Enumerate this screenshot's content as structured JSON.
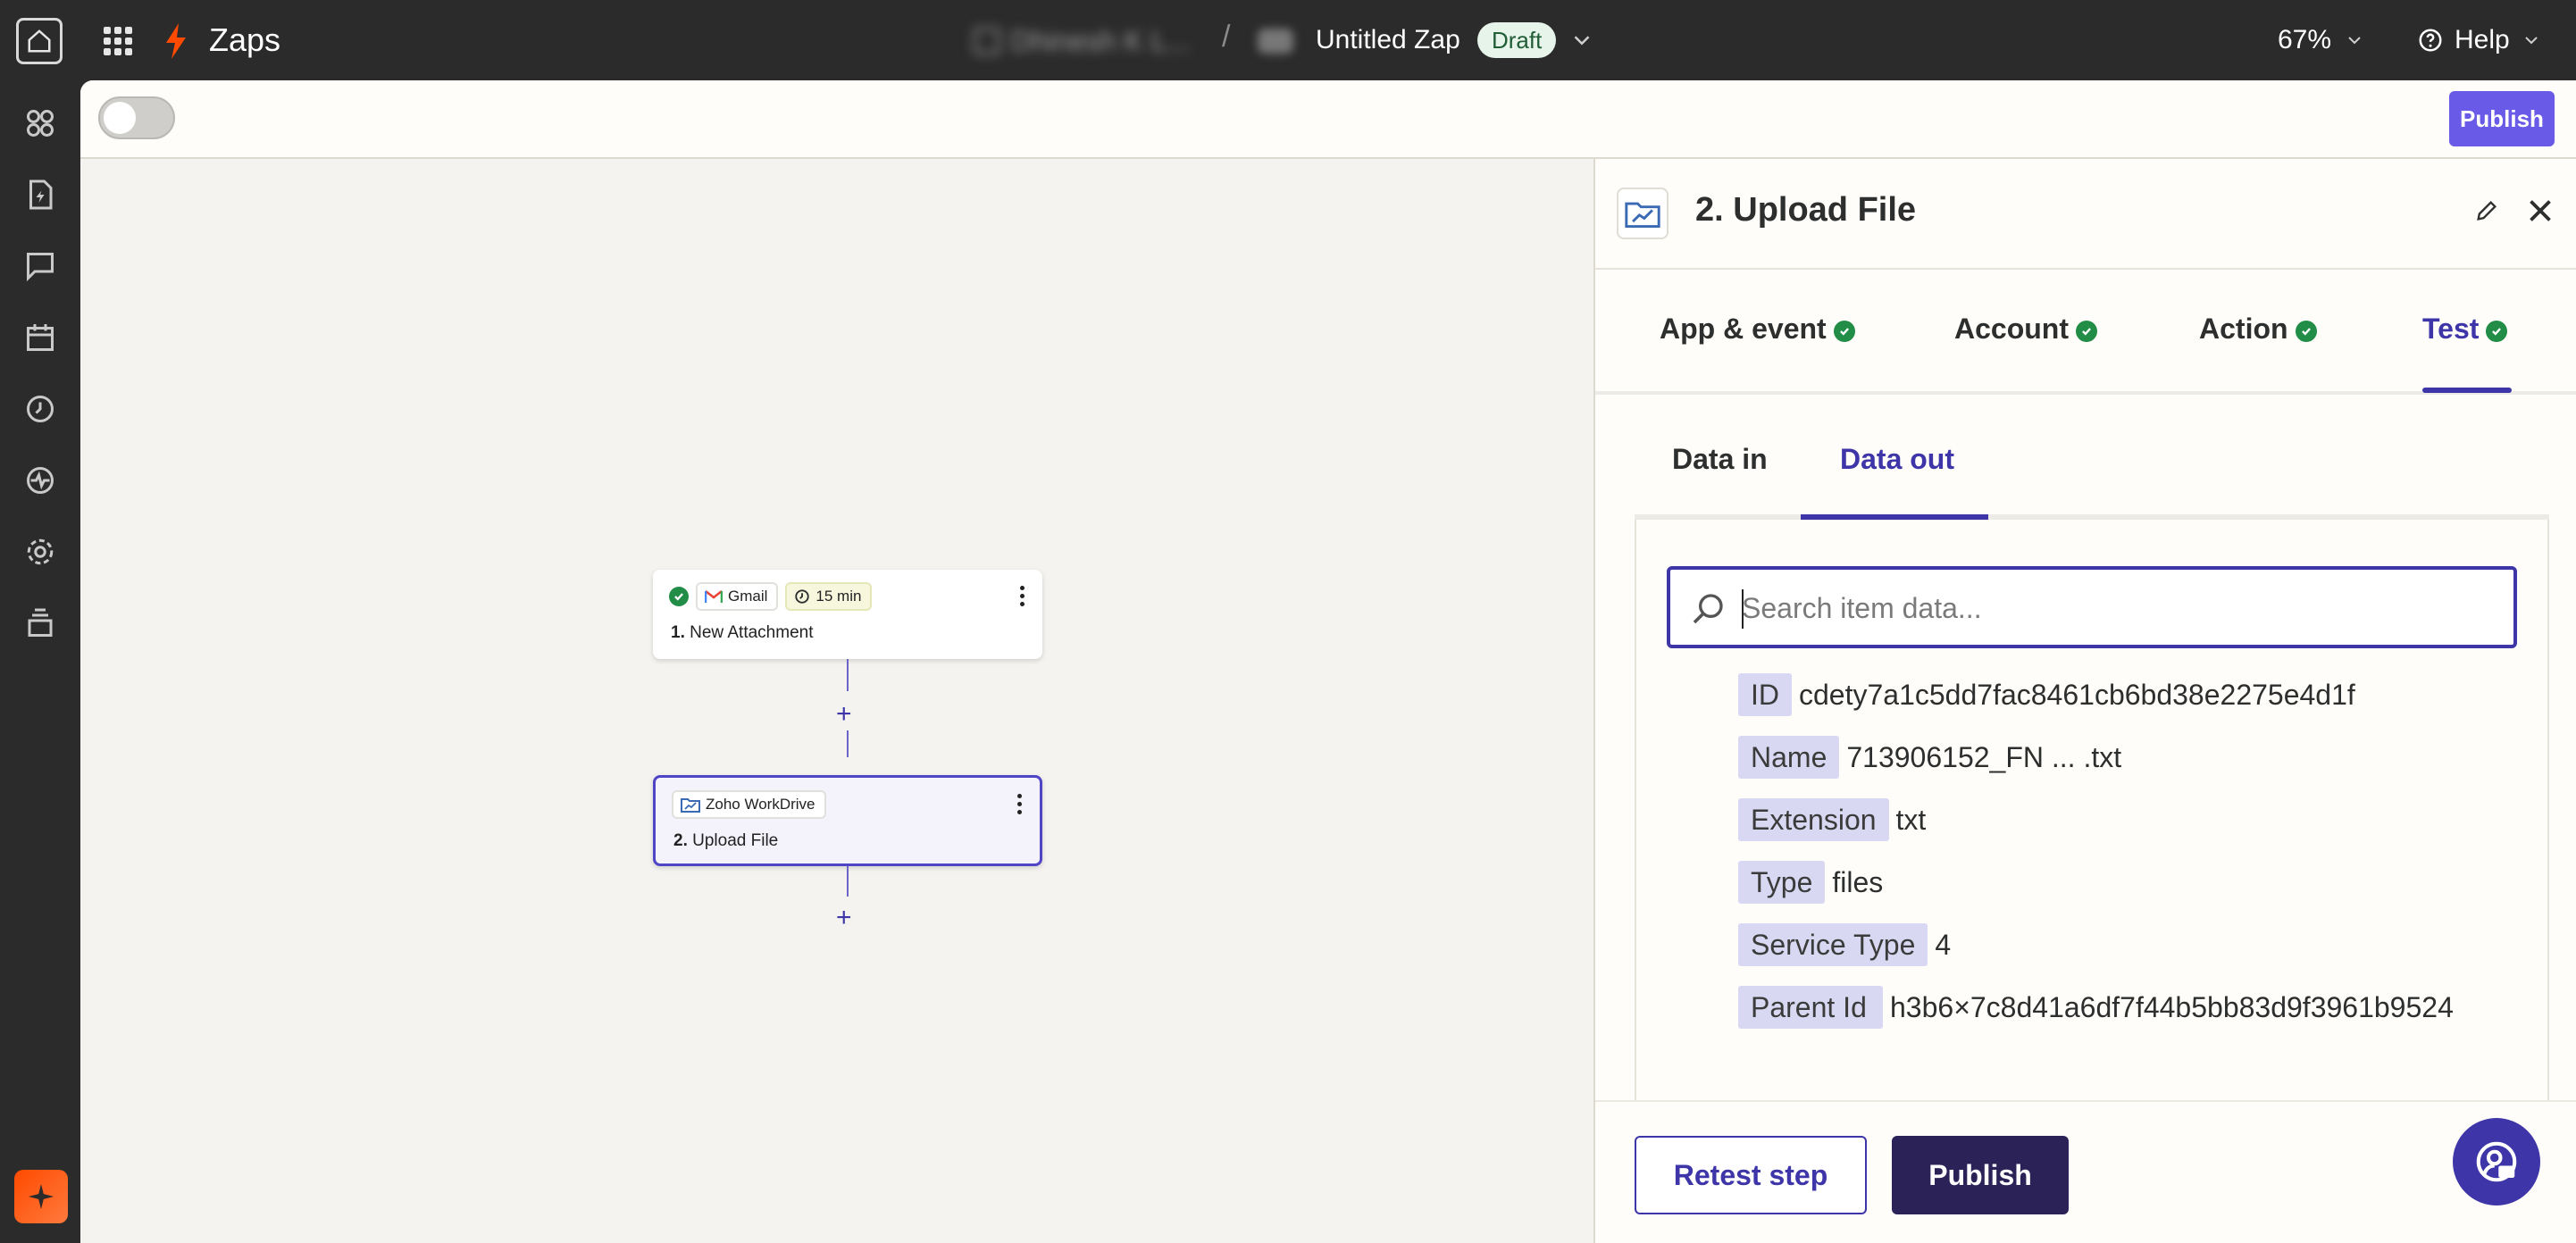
{
  "topbar": {
    "app_label": "Zaps",
    "crumb_folder_blurred": "Dhinesh K L...",
    "crumb_separator": "/",
    "zap_title": "Untitled Zap",
    "status_badge": "Draft",
    "zoom": "67%",
    "help_label": "Help"
  },
  "toolbar": {
    "publish_label": "Publish"
  },
  "canvas": {
    "node1": {
      "app": "Gmail",
      "interval": "15 min",
      "step_num": "1.",
      "title": "New Attachment"
    },
    "node2": {
      "app": "Zoho WorkDrive",
      "step_num": "2.",
      "title": "Upload File"
    },
    "plus": "+"
  },
  "panel": {
    "title": "2. Upload File",
    "steps": [
      "App & event",
      "Account",
      "Action",
      "Test"
    ],
    "subtabs": [
      "Data in",
      "Data out"
    ],
    "search_placeholder": "Search item data...",
    "fields": [
      {
        "key": "ID",
        "value": "cdety7a1c5dd7fac8461cb6bd38e2275e4d1f"
      },
      {
        "key": "Name",
        "value": "713906152_FN ... .txt"
      },
      {
        "key": "Extension",
        "value": "txt"
      },
      {
        "key": "Type",
        "value": "files"
      },
      {
        "key": "Service Type",
        "value": "4"
      },
      {
        "key": "Parent Id",
        "value": "h3b6×7c8d41a6df7f44b5bb83d9f3961b9524"
      }
    ],
    "retest_label": "Retest step",
    "publish_label": "Publish"
  },
  "colors": {
    "accent": "#3d35a8",
    "publish_top": "#695be8",
    "publish_dark": "#2b2358",
    "success": "#218d46",
    "brand_orange": "#ff4a00"
  }
}
